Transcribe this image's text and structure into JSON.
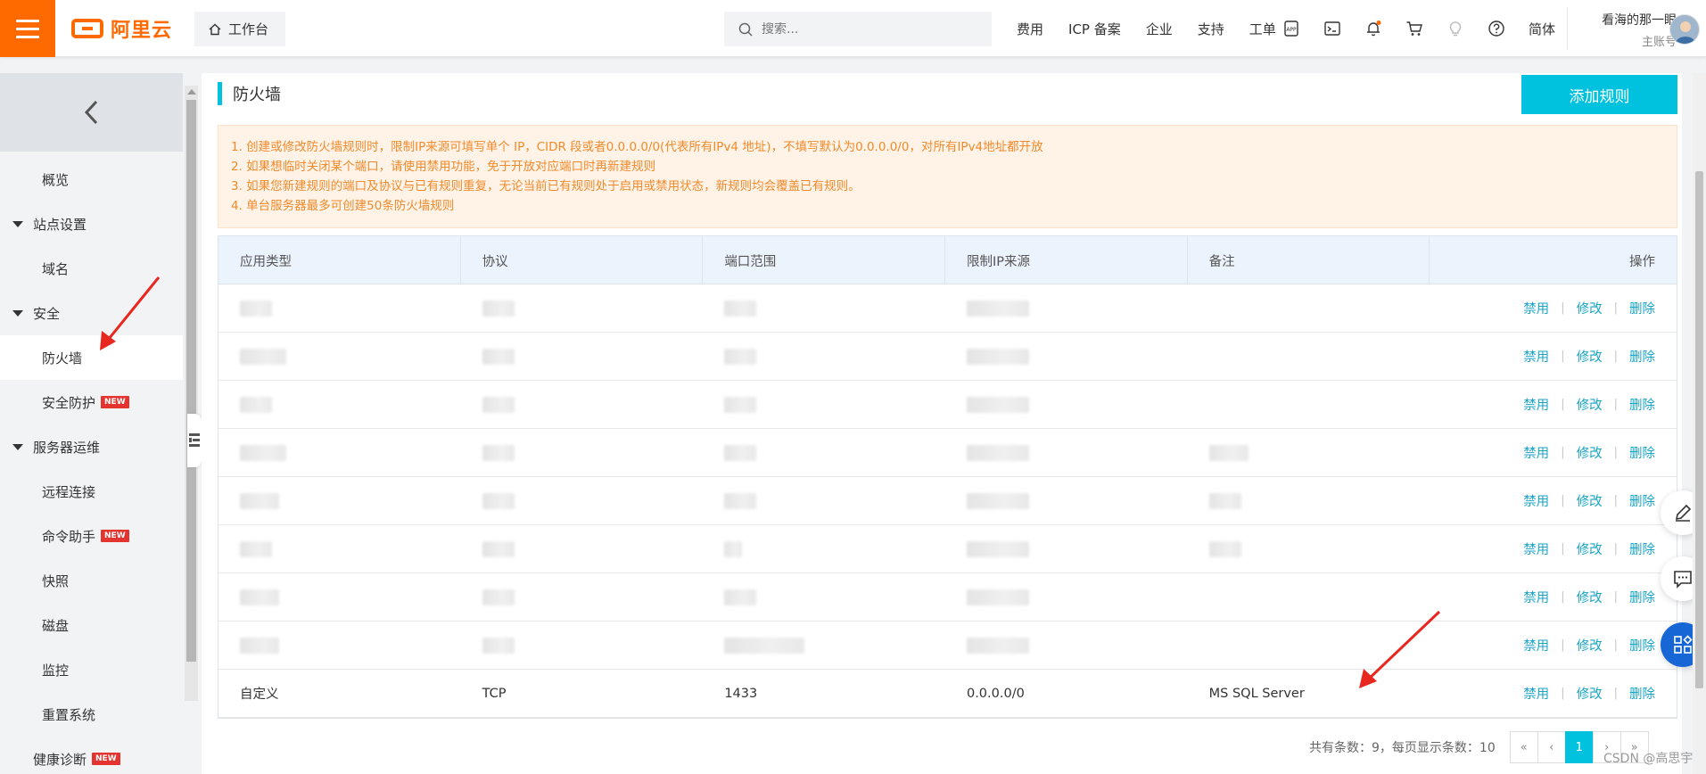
{
  "header": {
    "logo_text": "阿里云",
    "workbench_label": "工作台",
    "search_placeholder": "搜索...",
    "nav": [
      "费用",
      "ICP 备案",
      "企业",
      "支持",
      "工单"
    ],
    "icons": [
      "app-icon",
      "terminal-icon",
      "bell-icon",
      "cart-icon",
      "bulb-icon",
      "help-icon"
    ],
    "lang": "简体",
    "account_name": "看海的那一眼",
    "account_role": "主账号"
  },
  "sidebar": {
    "items": [
      {
        "label": "概览",
        "type": "item"
      },
      {
        "label": "站点设置",
        "type": "group"
      },
      {
        "label": "域名",
        "type": "item"
      },
      {
        "label": "安全",
        "type": "group"
      },
      {
        "label": "防火墙",
        "type": "item",
        "active": true
      },
      {
        "label": "安全防护",
        "type": "item",
        "badge": "NEW"
      },
      {
        "label": "服务器运维",
        "type": "group"
      },
      {
        "label": "远程连接",
        "type": "item"
      },
      {
        "label": "命令助手",
        "type": "item",
        "badge": "NEW"
      },
      {
        "label": "快照",
        "type": "item"
      },
      {
        "label": "磁盘",
        "type": "item"
      },
      {
        "label": "监控",
        "type": "item"
      },
      {
        "label": "重置系统",
        "type": "item"
      },
      {
        "label": "健康诊断",
        "type": "group",
        "badge": "NEW"
      }
    ]
  },
  "page": {
    "title": "防火墙",
    "add_rule_label": "添加规则",
    "notice_lines": [
      "1. 创建或修改防火墙规则时，限制IP来源可填写单个 IP，CIDR 段或者0.0.0.0/0(代表所有IPv4 地址)，不填写默认为0.0.0.0/0，对所有IPv4地址都开放",
      "2. 如果想临时关闭某个端口，请使用禁用功能，免于开放对应端口时再新建规则",
      "3. 如果您新建规则的端口及协议与已有规则重复，无论当前已有规则处于启用或禁用状态，新规则均会覆盖已有规则。",
      "4. 单台服务器最多可创建50条防火墙规则"
    ]
  },
  "table": {
    "columns": [
      "应用类型",
      "协议",
      "端口范围",
      "限制IP来源",
      "备注",
      "操作"
    ],
    "actions": [
      "禁用",
      "修改",
      "删除"
    ],
    "rows": [
      {
        "type": "",
        "protocol": "",
        "port": "",
        "ip": "",
        "note": "",
        "redacted": true
      },
      {
        "type": "",
        "protocol": "",
        "port": "",
        "ip": "",
        "note": "",
        "redacted": true
      },
      {
        "type": "",
        "protocol": "",
        "port": "",
        "ip": "",
        "note": "",
        "redacted": true
      },
      {
        "type": "",
        "protocol": "",
        "port": "",
        "ip": "",
        "note": "",
        "redacted": true
      },
      {
        "type": "",
        "protocol": "",
        "port": "",
        "ip": "",
        "note": "",
        "redacted": true
      },
      {
        "type": "",
        "protocol": "",
        "port": "",
        "ip": "",
        "note": "",
        "redacted": true
      },
      {
        "type": "",
        "protocol": "",
        "port": "",
        "ip": "",
        "note": "",
        "redacted": true
      },
      {
        "type": "",
        "protocol": "",
        "port": "",
        "ip": "",
        "note": "",
        "redacted": true
      },
      {
        "type": "自定义",
        "protocol": "TCP",
        "port": "1433",
        "ip": "0.0.0.0/0",
        "note": "MS SQL Server",
        "redacted": false
      }
    ]
  },
  "pager": {
    "summary": "共有条数：9，每页显示条数：10",
    "first": "«",
    "prev": "‹",
    "current": "1",
    "next": "›",
    "last": "»"
  },
  "watermark": "CSDN @高思宇",
  "colors": {
    "brand": "#ff6a00",
    "accent": "#00c1de",
    "link": "#1aa5c8",
    "notice_text": "#f08a2b",
    "badge": "#e3342f",
    "annotation": "#e8271f"
  }
}
